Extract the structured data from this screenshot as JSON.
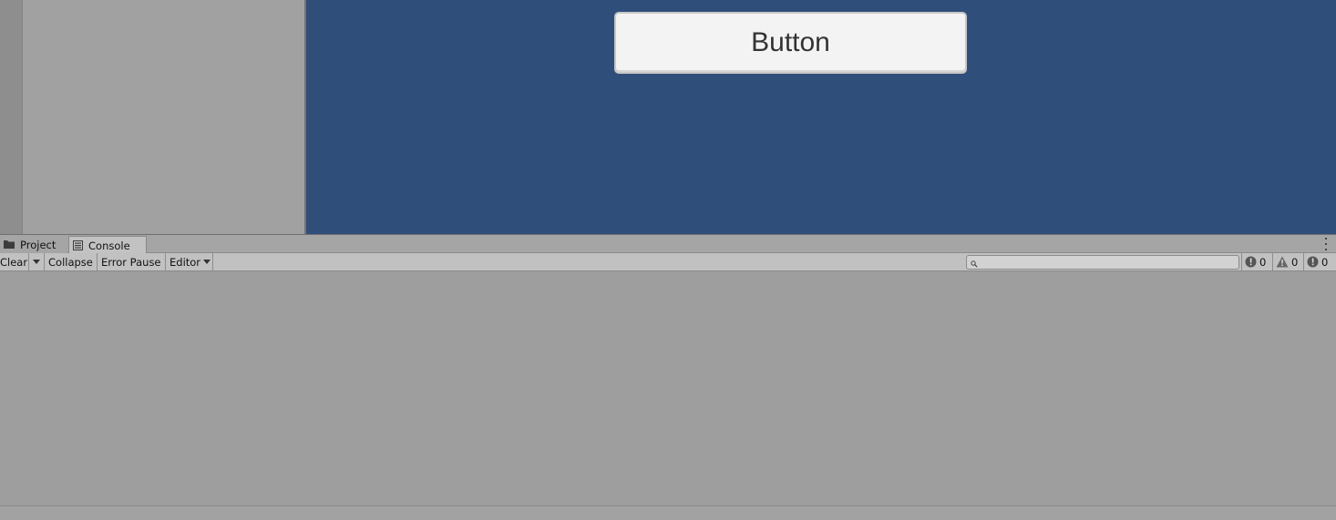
{
  "game_view": {
    "button_label": "Button",
    "background_color": "#304e7a"
  },
  "dock": {
    "tabs": [
      {
        "label": "Project",
        "icon": "folder-icon",
        "active": false
      },
      {
        "label": "Console",
        "icon": "console-icon",
        "active": true
      }
    ]
  },
  "console": {
    "toolbar": {
      "clear_label": "Clear",
      "collapse_label": "Collapse",
      "error_pause_label": "Error Pause",
      "editor_label": "Editor"
    },
    "search": {
      "value": "",
      "placeholder": ""
    },
    "counts": {
      "info": "0",
      "warnings": "0",
      "errors": "0"
    }
  }
}
